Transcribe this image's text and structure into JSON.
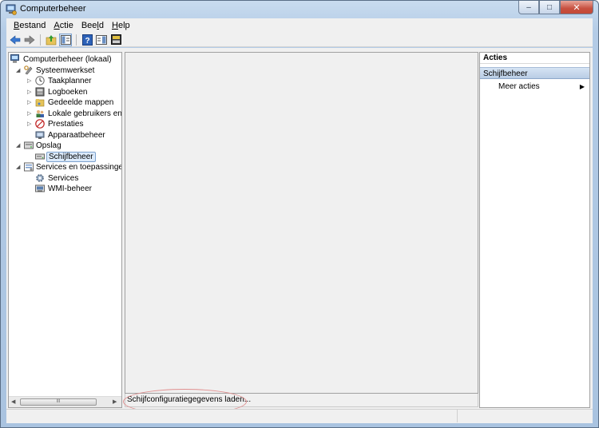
{
  "window": {
    "title": "Computerbeheer",
    "caption_buttons": {
      "minimize": "–",
      "maximize": "□",
      "close": "✕"
    }
  },
  "menu": [
    {
      "label": "Bestand",
      "accel": "B",
      "rest": "estand"
    },
    {
      "label": "Actie",
      "accel": "A",
      "rest": "ctie"
    },
    {
      "label": "Beeld",
      "accel": "B",
      "pre": "",
      "rest": "eeld",
      "mid_u": "l"
    },
    {
      "label": "Help",
      "accel": "H",
      "rest": "elp"
    }
  ],
  "menu_labels": {
    "m0a": "B",
    "m0b": "estand",
    "m1a": "A",
    "m1b": "ctie",
    "m2a": "Bee",
    "m2b": "l",
    "m2c": "d",
    "m3a": "H",
    "m3b": "elp"
  },
  "toolbar": {
    "icons": [
      "back-arrow-icon",
      "forward-arrow-icon",
      "up-folder-icon",
      "show-hide-console-tree-icon",
      "help-icon",
      "show-hide-action-pane-icon",
      "properties-icon"
    ]
  },
  "tree": {
    "root": "Computerbeheer (lokaal)",
    "items": [
      {
        "label": "Systeemwerkset",
        "level": 1,
        "expanded": true
      },
      {
        "label": "Taakplanner",
        "level": 2,
        "collapsed": true
      },
      {
        "label": "Logboeken",
        "level": 2,
        "collapsed": true
      },
      {
        "label": "Gedeelde mappen",
        "level": 2,
        "collapsed": true
      },
      {
        "label": "Lokale gebruikers en gr",
        "level": 2,
        "collapsed": true
      },
      {
        "label": "Prestaties",
        "level": 2,
        "collapsed": true
      },
      {
        "label": "Apparaatbeheer",
        "level": 2
      },
      {
        "label": "Opslag",
        "level": 1,
        "expanded": true
      },
      {
        "label": "Schijfbeheer",
        "level": 2,
        "selected": true
      },
      {
        "label": "Services en toepassingen",
        "level": 1,
        "expanded": true
      },
      {
        "label": "Services",
        "level": 2
      },
      {
        "label": "WMI-beheer",
        "level": 2
      }
    ],
    "scroll_thumb_label": "III"
  },
  "center": {
    "status_text": "Schijfconfiguratiegegevens laden..."
  },
  "actions": {
    "header": "Acties",
    "section": "Schijfbeheer",
    "more": "Meer acties"
  }
}
